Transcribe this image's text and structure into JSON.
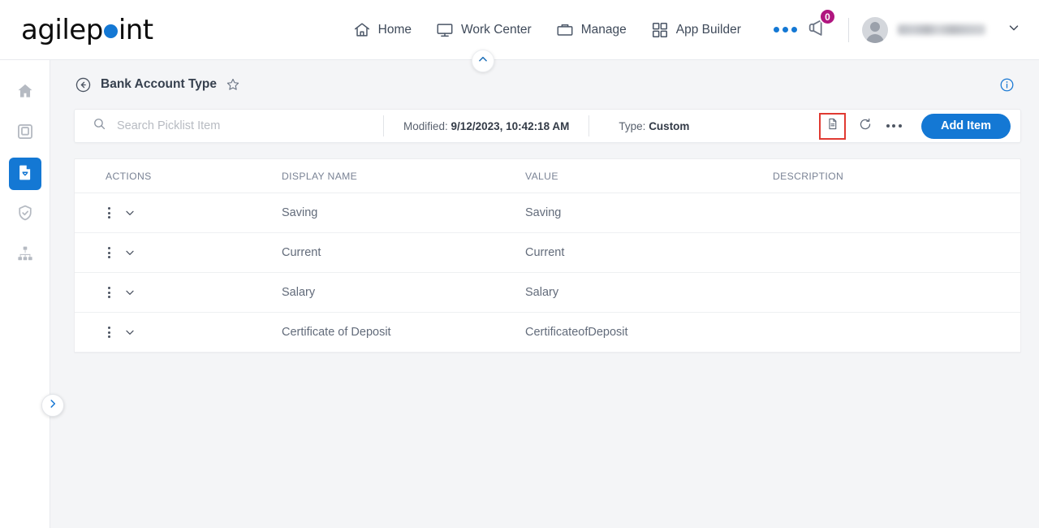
{
  "brand": {
    "name_part1": "agilep",
    "name_part2": "int",
    "dot_color": "#1478d4"
  },
  "topnav": {
    "items": [
      {
        "label": "Home",
        "icon": "home-icon"
      },
      {
        "label": "Work Center",
        "icon": "monitor-icon"
      },
      {
        "label": "Manage",
        "icon": "briefcase-icon"
      },
      {
        "label": "App Builder",
        "icon": "grid-icon"
      }
    ],
    "overflow_icon": "more-horizontal-icon",
    "announcement": {
      "icon": "megaphone-icon",
      "badge_count": "0",
      "badge_color": "#b0157f"
    },
    "user": {
      "avatar_icon": "avatar",
      "name": "",
      "caret_icon": "chevron-down-icon"
    }
  },
  "sidebar": {
    "items": [
      {
        "icon": "home-icon",
        "active": false
      },
      {
        "icon": "device-icon",
        "active": false
      },
      {
        "icon": "document-check-icon",
        "active": true
      },
      {
        "icon": "shield-check-icon",
        "active": false
      },
      {
        "icon": "sitemap-icon",
        "active": false
      }
    ],
    "toggle_icon": "chevron-right-icon"
  },
  "page": {
    "collapse_icon": "chevron-up-icon",
    "back_icon": "back-arrow-icon",
    "title": "Bank Account Type",
    "favorite_icon": "star-icon",
    "info_icon": "info-circle-icon"
  },
  "toolbar": {
    "search_icon": "search-icon",
    "search_value": "",
    "search_placeholder": "Search Picklist Item",
    "modified_label": "Modified:",
    "modified_value": "9/12/2023, 10:42:18 AM",
    "type_label": "Type:",
    "type_value": "Custom",
    "document_icon": "document-icon",
    "document_icon_highlight_color": "#e03a32",
    "refresh_icon": "refresh-icon",
    "more_icon": "more-horizontal-icon",
    "add_label": "Add Item",
    "add_color": "#1478d4"
  },
  "table": {
    "columns": [
      "ACTIONS",
      "DISPLAY NAME",
      "VALUE",
      "DESCRIPTION"
    ],
    "row_menu_icon": "kebab-menu-icon",
    "row_expand_icon": "chevron-down-icon",
    "rows": [
      {
        "display_name": "Saving",
        "value": "Saving",
        "description": ""
      },
      {
        "display_name": "Current",
        "value": "Current",
        "description": ""
      },
      {
        "display_name": "Salary",
        "value": "Salary",
        "description": ""
      },
      {
        "display_name": "Certificate of Deposit",
        "value": "CertificateofDeposit",
        "description": ""
      }
    ]
  }
}
